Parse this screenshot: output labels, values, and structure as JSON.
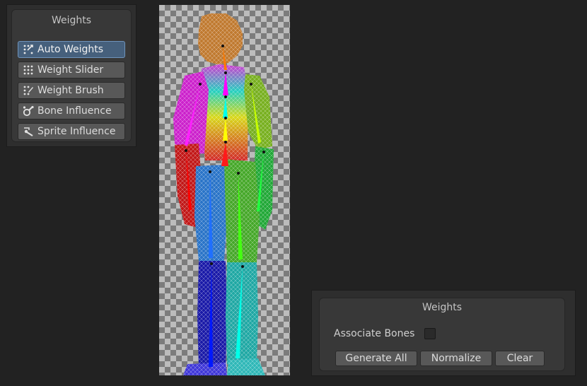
{
  "toolbar": {
    "title": "Weights",
    "buttons": [
      {
        "label": "Auto Weights",
        "icon": "auto-weights-icon",
        "active": true
      },
      {
        "label": "Weight Slider",
        "icon": "weight-slider-icon",
        "active": false
      },
      {
        "label": "Weight Brush",
        "icon": "weight-brush-icon",
        "active": false
      },
      {
        "label": "Bone Influence",
        "icon": "bone-influence-icon",
        "active": false
      },
      {
        "label": "Sprite Influence",
        "icon": "sprite-influence-icon",
        "active": false
      }
    ]
  },
  "weights_panel": {
    "title": "Weights",
    "associate_bones_label": "Associate Bones",
    "associate_bones_checked": false,
    "buttons": {
      "generate_all": "Generate All",
      "normalize": "Normalize",
      "clear": "Clear"
    }
  },
  "colors": {
    "active_button": "#46607c",
    "active_border": "#6f93bb",
    "head": "#c07a30",
    "neck_bone": "#ff7a00",
    "spine_1": "#ff00ff",
    "spine_2": "#00ffee",
    "spine_3": "#ffff00",
    "pelvis": "#ff1a1a",
    "left_upper_arm": "#ff20ff",
    "left_forearm": "#ff0000",
    "right_upper_arm": "#c8ff00",
    "right_forearm": "#20ff40",
    "left_thigh": "#1f6fff",
    "right_thigh": "#44ff10",
    "left_shin": "#0018ff",
    "right_shin": "#00ffe8"
  }
}
